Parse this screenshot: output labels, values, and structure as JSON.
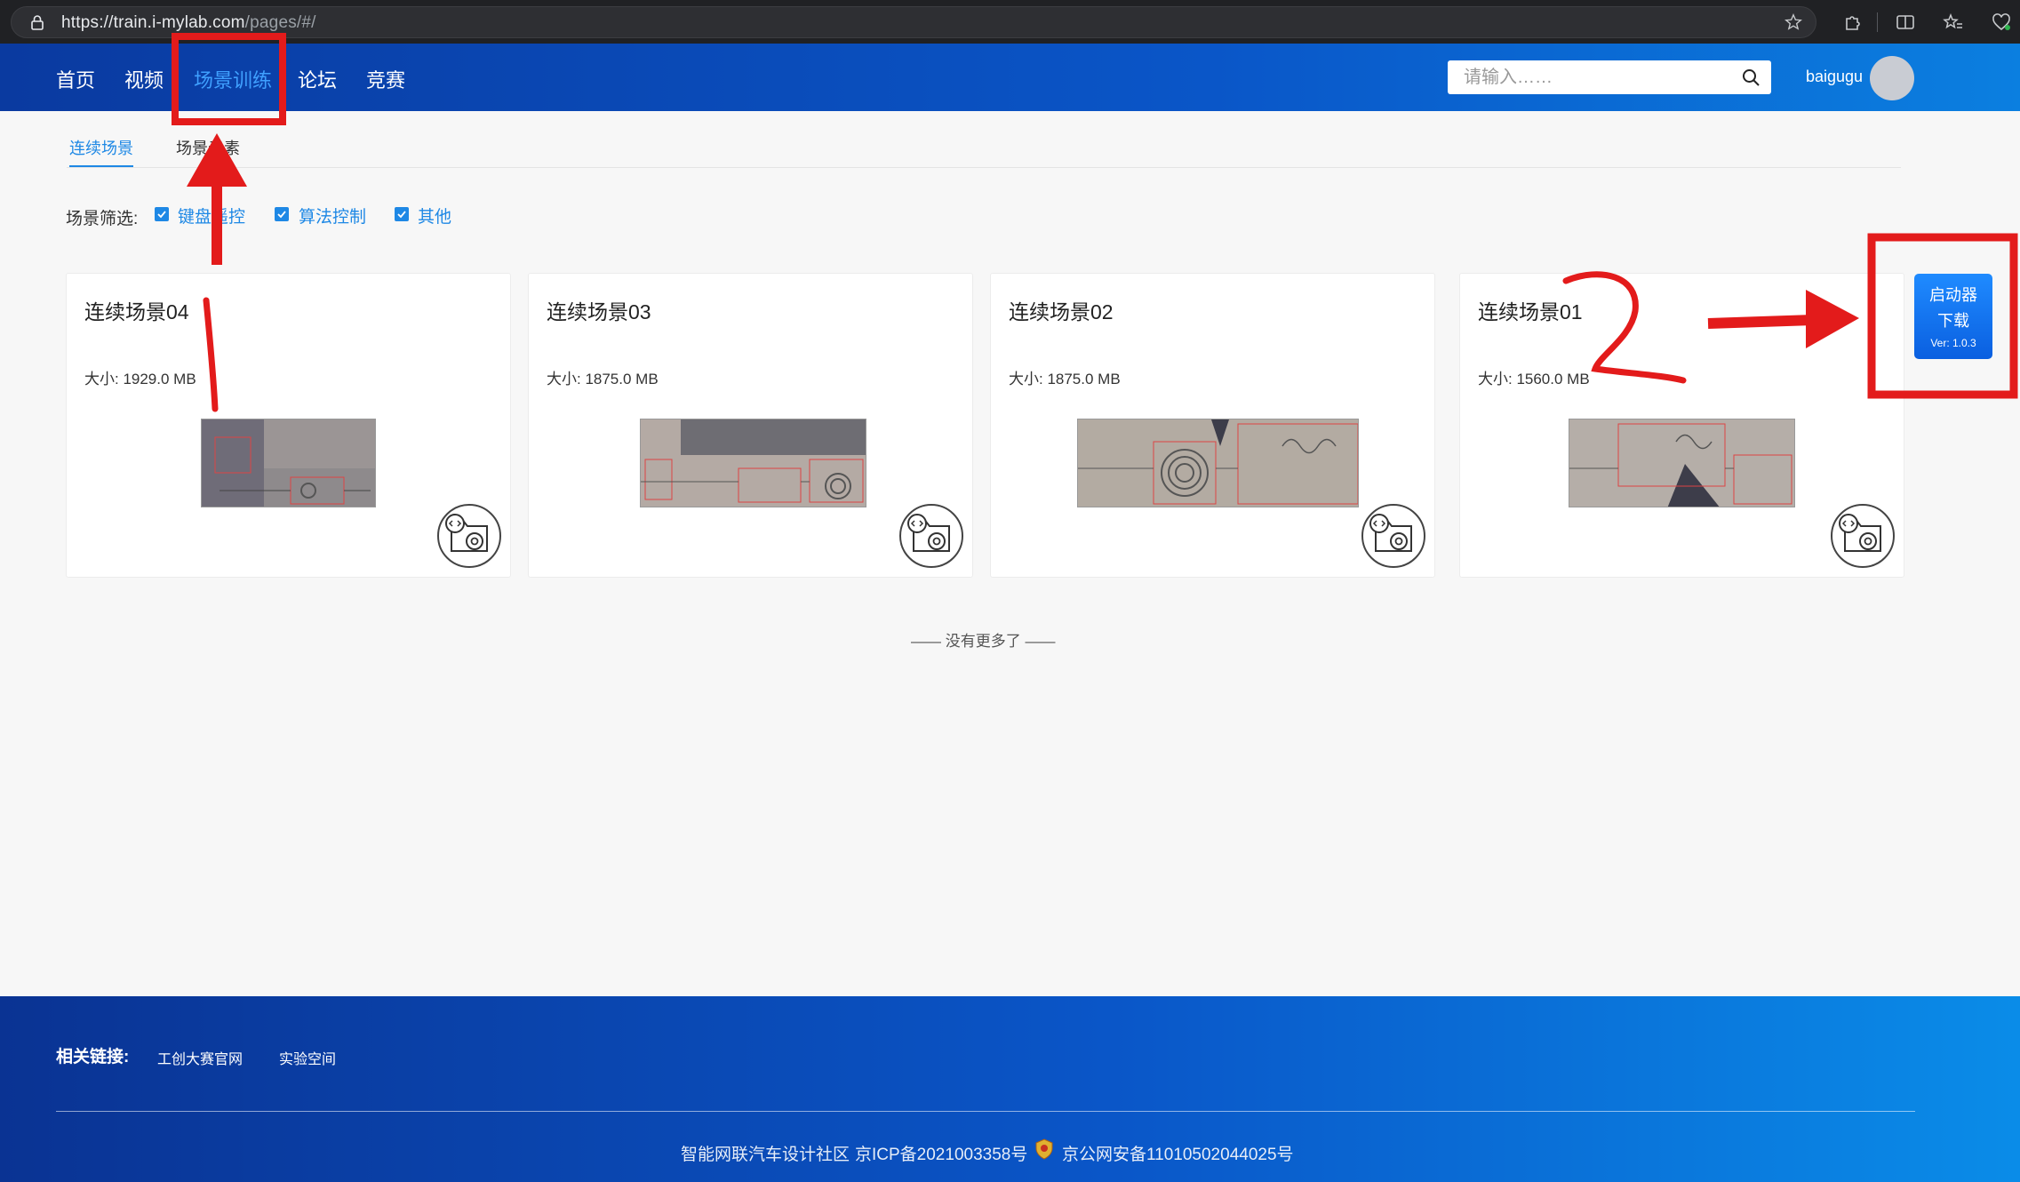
{
  "browser": {
    "url_host": "https://train.i-mylab.com",
    "url_path": "/pages/#/"
  },
  "nav": {
    "items": [
      {
        "label": "首页"
      },
      {
        "label": "视频"
      },
      {
        "label": "场景训练",
        "active": true
      },
      {
        "label": "论坛"
      },
      {
        "label": "竞赛"
      }
    ],
    "search_placeholder": "请输入……",
    "username": "baigugu"
  },
  "tabs": [
    {
      "label": "连续场景",
      "active": true
    },
    {
      "label": "场景元素"
    }
  ],
  "filters": {
    "label": "场景筛选:",
    "options": [
      {
        "label": "键盘遥控",
        "checked": true
      },
      {
        "label": "算法控制",
        "checked": true
      },
      {
        "label": "其他",
        "checked": true
      }
    ]
  },
  "cards": [
    {
      "title": "连续场景04",
      "size": "大小:  1929.0 MB"
    },
    {
      "title": "连续场景03",
      "size": "大小:  1875.0 MB"
    },
    {
      "title": "连续场景02",
      "size": "大小:  1875.0 MB"
    },
    {
      "title": "连续场景01",
      "size": "大小:  1560.0 MB"
    }
  ],
  "no_more": "—— 没有更多了 ——",
  "launcher": {
    "line1": "启动器",
    "line2": "下载",
    "version": "Ver: 1.0.3"
  },
  "footer": {
    "label": "相关链接:",
    "links": [
      "工创大赛官网",
      "实验空间"
    ],
    "org": "智能网联汽车设计社区",
    "icp": "京ICP备2021003358号",
    "police": "京公网安备11010502044025号"
  },
  "annotations": {
    "label_1": "1",
    "label_2": "2",
    "color": "#e31b1b"
  }
}
